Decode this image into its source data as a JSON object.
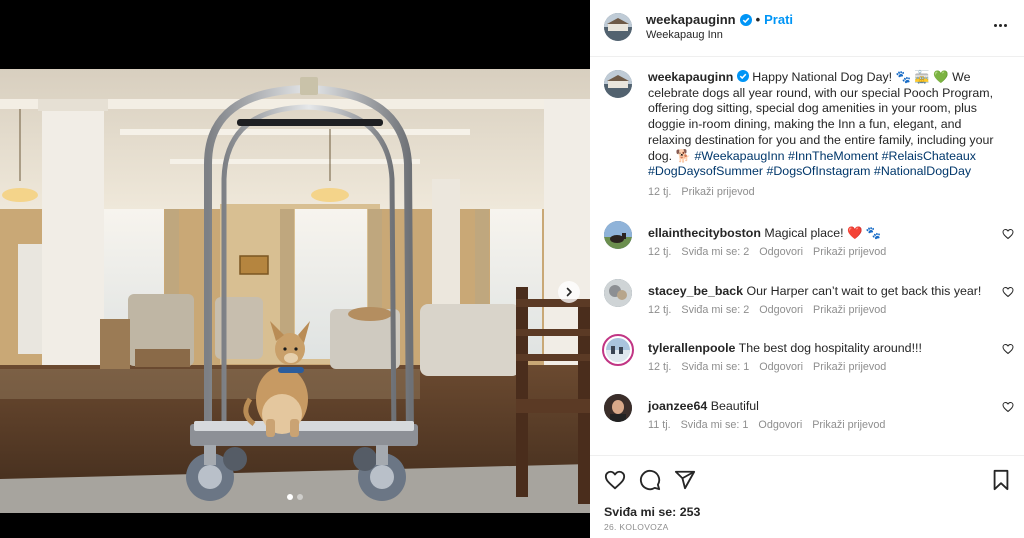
{
  "post": {
    "username": "weekapauginn",
    "location": "Weekapaug Inn",
    "follow_label": "Prati",
    "separator": "•",
    "caption_text": "Happy National Dog Day! 🐾 🚋 💚 We celebrate dogs all year round, with our special Pooch Program, offering dog sitting, special dog amenities in your room, plus doggie in-room dining, making the Inn a fun, elegant, and relaxing destination for you and the entire family, including your dog. 🐕",
    "hashtags": [
      "#WeekapaugInn",
      "#InnTheMoment",
      "#RelaisChateaux",
      "#DogDaysofSummer",
      "#DogsOfInstagram",
      "#NationalDogDay"
    ],
    "caption_age": "12 tj.",
    "translate_label": "Prikaži prijevod",
    "likes_text": "Sviđa mi se: 253",
    "date_text": "26. KOLOVOZA",
    "carousel": {
      "total": 2,
      "current": 1
    }
  },
  "comments": [
    {
      "username": "ellainthecityboston",
      "text": "Magical place! ❤️ 🐾",
      "age": "12 tj.",
      "likes": "Sviđa mi se: 2",
      "reply": "Odgovori",
      "translate": "Prikaži prijevod"
    },
    {
      "username": "stacey_be_back",
      "text": "Our Harper can’t wait to get back this year!",
      "age": "12 tj.",
      "likes": "Sviđa mi se: 2",
      "reply": "Odgovori",
      "translate": "Prikaži prijevod"
    },
    {
      "username": "tylerallenpoole",
      "text": "The best dog hospitality around!!!",
      "age": "12 tj.",
      "likes": "Sviđa mi se: 1",
      "reply": "Odgovori",
      "translate": "Prikaži prijevod"
    },
    {
      "username": "joanzee64",
      "text": "Beautiful",
      "age": "11 tj.",
      "likes": "Sviđa mi se: 1",
      "reply": "Odgovori",
      "translate": "Prikaži prijevod"
    }
  ],
  "icons": [
    "verified-badge-icon",
    "more-options-icon",
    "heart-icon",
    "comment-icon",
    "share-icon",
    "bookmark-icon",
    "chevron-right-icon"
  ],
  "colors": {
    "follow": "#0095f6",
    "hashtag": "#00376b",
    "muted": "#8e8e8e",
    "verified": "#0095f6",
    "heart_red": "#ed4956"
  }
}
